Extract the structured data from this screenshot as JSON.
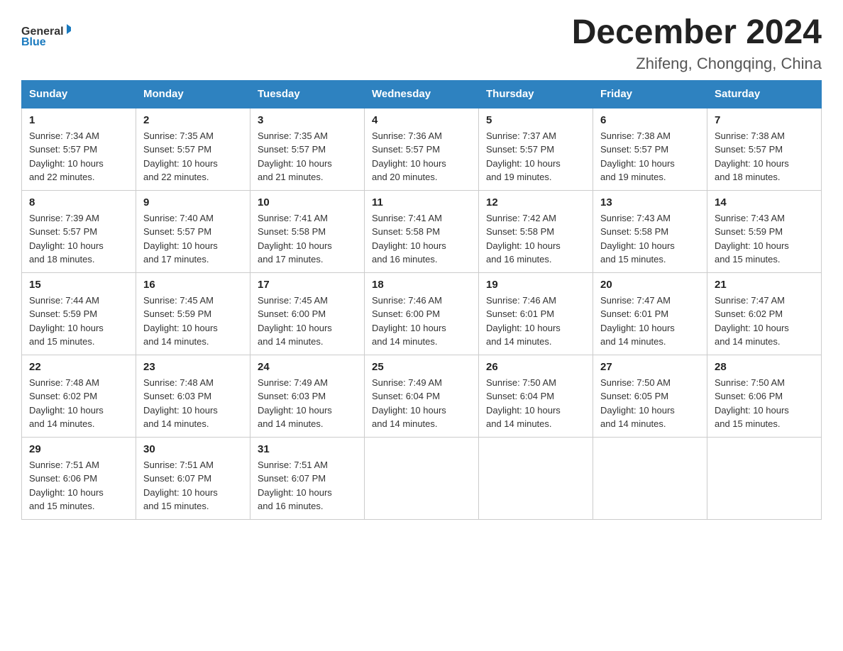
{
  "header": {
    "logo_general": "General",
    "logo_blue": "Blue",
    "month_year": "December 2024",
    "location": "Zhifeng, Chongqing, China"
  },
  "weekdays": [
    "Sunday",
    "Monday",
    "Tuesday",
    "Wednesday",
    "Thursday",
    "Friday",
    "Saturday"
  ],
  "weeks": [
    [
      {
        "day": "1",
        "sunrise": "7:34 AM",
        "sunset": "5:57 PM",
        "daylight": "10 hours and 22 minutes."
      },
      {
        "day": "2",
        "sunrise": "7:35 AM",
        "sunset": "5:57 PM",
        "daylight": "10 hours and 22 minutes."
      },
      {
        "day": "3",
        "sunrise": "7:35 AM",
        "sunset": "5:57 PM",
        "daylight": "10 hours and 21 minutes."
      },
      {
        "day": "4",
        "sunrise": "7:36 AM",
        "sunset": "5:57 PM",
        "daylight": "10 hours and 20 minutes."
      },
      {
        "day": "5",
        "sunrise": "7:37 AM",
        "sunset": "5:57 PM",
        "daylight": "10 hours and 19 minutes."
      },
      {
        "day": "6",
        "sunrise": "7:38 AM",
        "sunset": "5:57 PM",
        "daylight": "10 hours and 19 minutes."
      },
      {
        "day": "7",
        "sunrise": "7:38 AM",
        "sunset": "5:57 PM",
        "daylight": "10 hours and 18 minutes."
      }
    ],
    [
      {
        "day": "8",
        "sunrise": "7:39 AM",
        "sunset": "5:57 PM",
        "daylight": "10 hours and 18 minutes."
      },
      {
        "day": "9",
        "sunrise": "7:40 AM",
        "sunset": "5:57 PM",
        "daylight": "10 hours and 17 minutes."
      },
      {
        "day": "10",
        "sunrise": "7:41 AM",
        "sunset": "5:58 PM",
        "daylight": "10 hours and 17 minutes."
      },
      {
        "day": "11",
        "sunrise": "7:41 AM",
        "sunset": "5:58 PM",
        "daylight": "10 hours and 16 minutes."
      },
      {
        "day": "12",
        "sunrise": "7:42 AM",
        "sunset": "5:58 PM",
        "daylight": "10 hours and 16 minutes."
      },
      {
        "day": "13",
        "sunrise": "7:43 AM",
        "sunset": "5:58 PM",
        "daylight": "10 hours and 15 minutes."
      },
      {
        "day": "14",
        "sunrise": "7:43 AM",
        "sunset": "5:59 PM",
        "daylight": "10 hours and 15 minutes."
      }
    ],
    [
      {
        "day": "15",
        "sunrise": "7:44 AM",
        "sunset": "5:59 PM",
        "daylight": "10 hours and 15 minutes."
      },
      {
        "day": "16",
        "sunrise": "7:45 AM",
        "sunset": "5:59 PM",
        "daylight": "10 hours and 14 minutes."
      },
      {
        "day": "17",
        "sunrise": "7:45 AM",
        "sunset": "6:00 PM",
        "daylight": "10 hours and 14 minutes."
      },
      {
        "day": "18",
        "sunrise": "7:46 AM",
        "sunset": "6:00 PM",
        "daylight": "10 hours and 14 minutes."
      },
      {
        "day": "19",
        "sunrise": "7:46 AM",
        "sunset": "6:01 PM",
        "daylight": "10 hours and 14 minutes."
      },
      {
        "day": "20",
        "sunrise": "7:47 AM",
        "sunset": "6:01 PM",
        "daylight": "10 hours and 14 minutes."
      },
      {
        "day": "21",
        "sunrise": "7:47 AM",
        "sunset": "6:02 PM",
        "daylight": "10 hours and 14 minutes."
      }
    ],
    [
      {
        "day": "22",
        "sunrise": "7:48 AM",
        "sunset": "6:02 PM",
        "daylight": "10 hours and 14 minutes."
      },
      {
        "day": "23",
        "sunrise": "7:48 AM",
        "sunset": "6:03 PM",
        "daylight": "10 hours and 14 minutes."
      },
      {
        "day": "24",
        "sunrise": "7:49 AM",
        "sunset": "6:03 PM",
        "daylight": "10 hours and 14 minutes."
      },
      {
        "day": "25",
        "sunrise": "7:49 AM",
        "sunset": "6:04 PM",
        "daylight": "10 hours and 14 minutes."
      },
      {
        "day": "26",
        "sunrise": "7:50 AM",
        "sunset": "6:04 PM",
        "daylight": "10 hours and 14 minutes."
      },
      {
        "day": "27",
        "sunrise": "7:50 AM",
        "sunset": "6:05 PM",
        "daylight": "10 hours and 14 minutes."
      },
      {
        "day": "28",
        "sunrise": "7:50 AM",
        "sunset": "6:06 PM",
        "daylight": "10 hours and 15 minutes."
      }
    ],
    [
      {
        "day": "29",
        "sunrise": "7:51 AM",
        "sunset": "6:06 PM",
        "daylight": "10 hours and 15 minutes."
      },
      {
        "day": "30",
        "sunrise": "7:51 AM",
        "sunset": "6:07 PM",
        "daylight": "10 hours and 15 minutes."
      },
      {
        "day": "31",
        "sunrise": "7:51 AM",
        "sunset": "6:07 PM",
        "daylight": "10 hours and 16 minutes."
      },
      null,
      null,
      null,
      null
    ]
  ],
  "labels": {
    "sunrise_label": "Sunrise:",
    "sunset_label": "Sunset:",
    "daylight_label": "Daylight:"
  }
}
